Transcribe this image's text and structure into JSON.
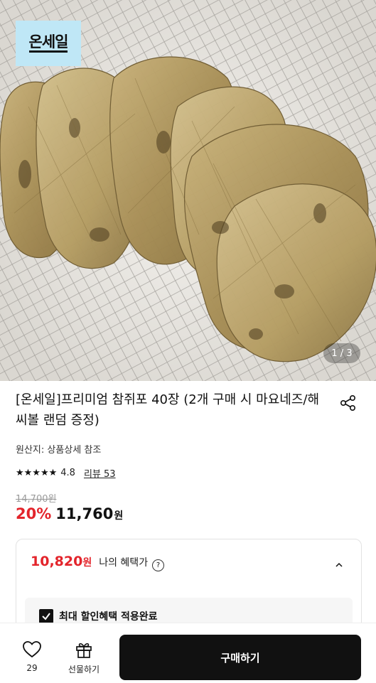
{
  "hero": {
    "brand_badge": "온세일",
    "image_counter": "1 / 3"
  },
  "product": {
    "title": "[온세일]프리미엄 참쥐포 40장 (2개 구매 시 마요네즈/해씨볼 랜덤 증정)",
    "origin": "원산지: 상품상세 참조",
    "stars": "★★★★★",
    "rating": "4.8",
    "review_link": "리뷰 53",
    "original_price": "14,700원",
    "discount": "20%",
    "price": "11,760",
    "price_unit": "원"
  },
  "benefit": {
    "price": "10,820",
    "price_unit": "원",
    "label": "나의 혜택가",
    "help_symbol": "?",
    "max_discount_label": "최대 할인혜택 적용완료"
  },
  "bottom_bar": {
    "wish_count": "29",
    "gift_label": "선물하기",
    "buy_label": "구매하기"
  },
  "colors": {
    "accent_red": "#e3242b",
    "button_black": "#111111",
    "badge_blue": "#bfe7f6"
  },
  "icons": [
    "share-icon",
    "chevron-up-icon",
    "help-icon",
    "check-icon",
    "heart-icon",
    "gift-icon"
  ]
}
